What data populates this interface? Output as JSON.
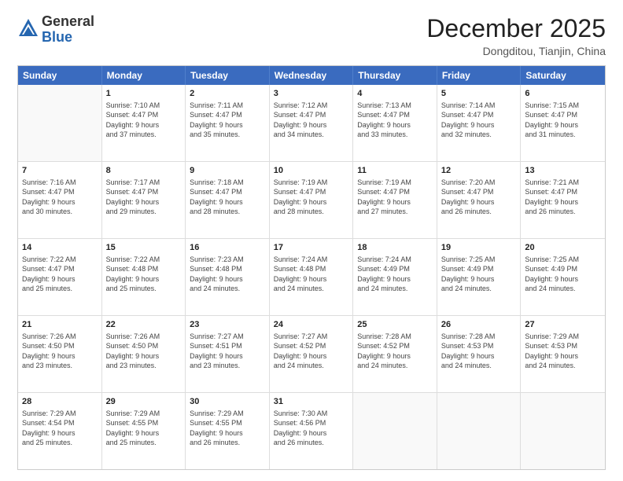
{
  "header": {
    "logo_general": "General",
    "logo_blue": "Blue",
    "month_title": "December 2025",
    "location": "Dongditou, Tianjin, China"
  },
  "weekdays": [
    "Sunday",
    "Monday",
    "Tuesday",
    "Wednesday",
    "Thursday",
    "Friday",
    "Saturday"
  ],
  "rows": [
    [
      {
        "day": "",
        "lines": [],
        "empty": true
      },
      {
        "day": "1",
        "lines": [
          "Sunrise: 7:10 AM",
          "Sunset: 4:47 PM",
          "Daylight: 9 hours",
          "and 37 minutes."
        ]
      },
      {
        "day": "2",
        "lines": [
          "Sunrise: 7:11 AM",
          "Sunset: 4:47 PM",
          "Daylight: 9 hours",
          "and 35 minutes."
        ]
      },
      {
        "day": "3",
        "lines": [
          "Sunrise: 7:12 AM",
          "Sunset: 4:47 PM",
          "Daylight: 9 hours",
          "and 34 minutes."
        ]
      },
      {
        "day": "4",
        "lines": [
          "Sunrise: 7:13 AM",
          "Sunset: 4:47 PM",
          "Daylight: 9 hours",
          "and 33 minutes."
        ]
      },
      {
        "day": "5",
        "lines": [
          "Sunrise: 7:14 AM",
          "Sunset: 4:47 PM",
          "Daylight: 9 hours",
          "and 32 minutes."
        ]
      },
      {
        "day": "6",
        "lines": [
          "Sunrise: 7:15 AM",
          "Sunset: 4:47 PM",
          "Daylight: 9 hours",
          "and 31 minutes."
        ]
      }
    ],
    [
      {
        "day": "7",
        "lines": [
          "Sunrise: 7:16 AM",
          "Sunset: 4:47 PM",
          "Daylight: 9 hours",
          "and 30 minutes."
        ]
      },
      {
        "day": "8",
        "lines": [
          "Sunrise: 7:17 AM",
          "Sunset: 4:47 PM",
          "Daylight: 9 hours",
          "and 29 minutes."
        ]
      },
      {
        "day": "9",
        "lines": [
          "Sunrise: 7:18 AM",
          "Sunset: 4:47 PM",
          "Daylight: 9 hours",
          "and 28 minutes."
        ]
      },
      {
        "day": "10",
        "lines": [
          "Sunrise: 7:19 AM",
          "Sunset: 4:47 PM",
          "Daylight: 9 hours",
          "and 28 minutes."
        ]
      },
      {
        "day": "11",
        "lines": [
          "Sunrise: 7:19 AM",
          "Sunset: 4:47 PM",
          "Daylight: 9 hours",
          "and 27 minutes."
        ]
      },
      {
        "day": "12",
        "lines": [
          "Sunrise: 7:20 AM",
          "Sunset: 4:47 PM",
          "Daylight: 9 hours",
          "and 26 minutes."
        ]
      },
      {
        "day": "13",
        "lines": [
          "Sunrise: 7:21 AM",
          "Sunset: 4:47 PM",
          "Daylight: 9 hours",
          "and 26 minutes."
        ]
      }
    ],
    [
      {
        "day": "14",
        "lines": [
          "Sunrise: 7:22 AM",
          "Sunset: 4:47 PM",
          "Daylight: 9 hours",
          "and 25 minutes."
        ]
      },
      {
        "day": "15",
        "lines": [
          "Sunrise: 7:22 AM",
          "Sunset: 4:48 PM",
          "Daylight: 9 hours",
          "and 25 minutes."
        ]
      },
      {
        "day": "16",
        "lines": [
          "Sunrise: 7:23 AM",
          "Sunset: 4:48 PM",
          "Daylight: 9 hours",
          "and 24 minutes."
        ]
      },
      {
        "day": "17",
        "lines": [
          "Sunrise: 7:24 AM",
          "Sunset: 4:48 PM",
          "Daylight: 9 hours",
          "and 24 minutes."
        ]
      },
      {
        "day": "18",
        "lines": [
          "Sunrise: 7:24 AM",
          "Sunset: 4:49 PM",
          "Daylight: 9 hours",
          "and 24 minutes."
        ]
      },
      {
        "day": "19",
        "lines": [
          "Sunrise: 7:25 AM",
          "Sunset: 4:49 PM",
          "Daylight: 9 hours",
          "and 24 minutes."
        ]
      },
      {
        "day": "20",
        "lines": [
          "Sunrise: 7:25 AM",
          "Sunset: 4:49 PM",
          "Daylight: 9 hours",
          "and 24 minutes."
        ]
      }
    ],
    [
      {
        "day": "21",
        "lines": [
          "Sunrise: 7:26 AM",
          "Sunset: 4:50 PM",
          "Daylight: 9 hours",
          "and 23 minutes."
        ]
      },
      {
        "day": "22",
        "lines": [
          "Sunrise: 7:26 AM",
          "Sunset: 4:50 PM",
          "Daylight: 9 hours",
          "and 23 minutes."
        ]
      },
      {
        "day": "23",
        "lines": [
          "Sunrise: 7:27 AM",
          "Sunset: 4:51 PM",
          "Daylight: 9 hours",
          "and 23 minutes."
        ]
      },
      {
        "day": "24",
        "lines": [
          "Sunrise: 7:27 AM",
          "Sunset: 4:52 PM",
          "Daylight: 9 hours",
          "and 24 minutes."
        ]
      },
      {
        "day": "25",
        "lines": [
          "Sunrise: 7:28 AM",
          "Sunset: 4:52 PM",
          "Daylight: 9 hours",
          "and 24 minutes."
        ]
      },
      {
        "day": "26",
        "lines": [
          "Sunrise: 7:28 AM",
          "Sunset: 4:53 PM",
          "Daylight: 9 hours",
          "and 24 minutes."
        ]
      },
      {
        "day": "27",
        "lines": [
          "Sunrise: 7:29 AM",
          "Sunset: 4:53 PM",
          "Daylight: 9 hours",
          "and 24 minutes."
        ]
      }
    ],
    [
      {
        "day": "28",
        "lines": [
          "Sunrise: 7:29 AM",
          "Sunset: 4:54 PM",
          "Daylight: 9 hours",
          "and 25 minutes."
        ]
      },
      {
        "day": "29",
        "lines": [
          "Sunrise: 7:29 AM",
          "Sunset: 4:55 PM",
          "Daylight: 9 hours",
          "and 25 minutes."
        ]
      },
      {
        "day": "30",
        "lines": [
          "Sunrise: 7:29 AM",
          "Sunset: 4:55 PM",
          "Daylight: 9 hours",
          "and 26 minutes."
        ]
      },
      {
        "day": "31",
        "lines": [
          "Sunrise: 7:30 AM",
          "Sunset: 4:56 PM",
          "Daylight: 9 hours",
          "and 26 minutes."
        ]
      },
      {
        "day": "",
        "lines": [],
        "empty": true
      },
      {
        "day": "",
        "lines": [],
        "empty": true
      },
      {
        "day": "",
        "lines": [],
        "empty": true
      }
    ]
  ]
}
